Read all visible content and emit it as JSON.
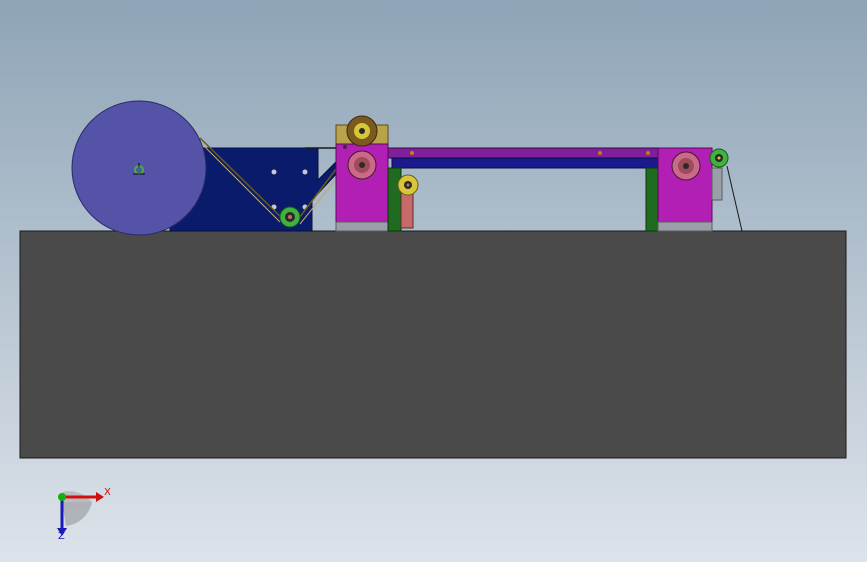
{
  "viewport": {
    "background_top": "#8ea4b7",
    "background_bottom": "#dde3ea"
  },
  "colors": {
    "base_block": "#4a4a4a",
    "reel": "#5553a8",
    "motor_housing": "#0a1b6b",
    "frame_magenta": "#b21fb4",
    "rail_purple": "#7f1f99",
    "rail_blue": "#1a1a8c",
    "post_green": "#1f6b1f",
    "roller_brown": "#7a5a1f",
    "roller_yellow": "#d8c63a",
    "roller_green": "#3fb23f",
    "belt": "#6b5a1a",
    "pink_block": "#c96a6a"
  },
  "components": [
    {
      "name": "base-block"
    },
    {
      "name": "tape-reel"
    },
    {
      "name": "motor-housing"
    },
    {
      "name": "feed-frame-left"
    },
    {
      "name": "feed-frame-right"
    },
    {
      "name": "top-rail"
    },
    {
      "name": "drive-roller"
    }
  ],
  "axis_triad": {
    "x_label": "X",
    "z_label": "Z",
    "x_color": "#d01010",
    "y_color": "#10b010",
    "z_color": "#1a1ab8"
  }
}
